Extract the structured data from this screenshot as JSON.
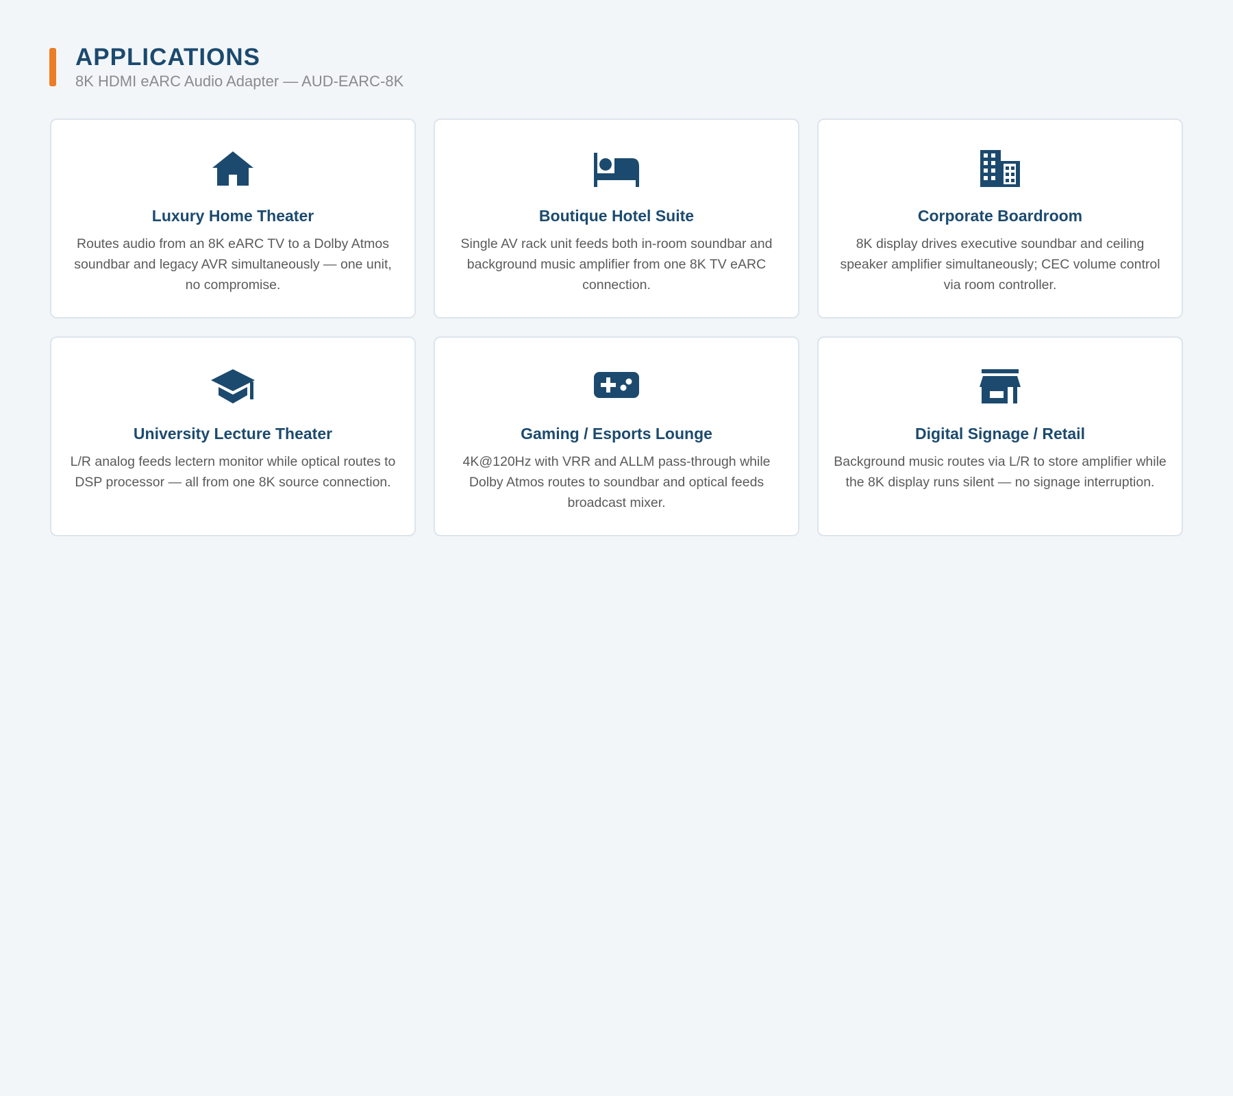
{
  "header": {
    "title": "APPLICATIONS",
    "subtitle": "8K HDMI eARC Audio Adapter — AUD-EARC-8K"
  },
  "colors": {
    "background": "#f3f6f9",
    "accent": "#ec7c25",
    "primary": "#1c4a6e",
    "text": "#5a5a5a",
    "subtitle": "#8a8a8a"
  },
  "cards": [
    {
      "icon": "home-icon",
      "title": "Luxury Home Theater",
      "description": "Routes audio from an 8K eARC TV to a Dolby Atmos soundbar and legacy AVR simultaneously — one unit, no compromise."
    },
    {
      "icon": "bed-icon",
      "title": "Boutique Hotel Suite",
      "description": "Single AV rack unit feeds both in-room soundbar and background music amplifier from one 8K TV eARC connection."
    },
    {
      "icon": "building-icon",
      "title": "Corporate Boardroom",
      "description": "8K display drives executive soundbar and ceiling speaker amplifier simultaneously; CEC volume control via room controller."
    },
    {
      "icon": "graduation-cap-icon",
      "title": "University Lecture Theater",
      "description": "L/R analog feeds lectern monitor while optical routes to DSP processor — all from one 8K source connection."
    },
    {
      "icon": "gamepad-icon",
      "title": "Gaming / Esports Lounge",
      "description": "4K@120Hz with VRR and ALLM pass-through while Dolby Atmos routes to soundbar and optical feeds broadcast mixer."
    },
    {
      "icon": "store-icon",
      "title": "Digital Signage / Retail",
      "description": "Background music routes via L/R to store amplifier while the 8K display runs silent — no signage interruption."
    }
  ]
}
